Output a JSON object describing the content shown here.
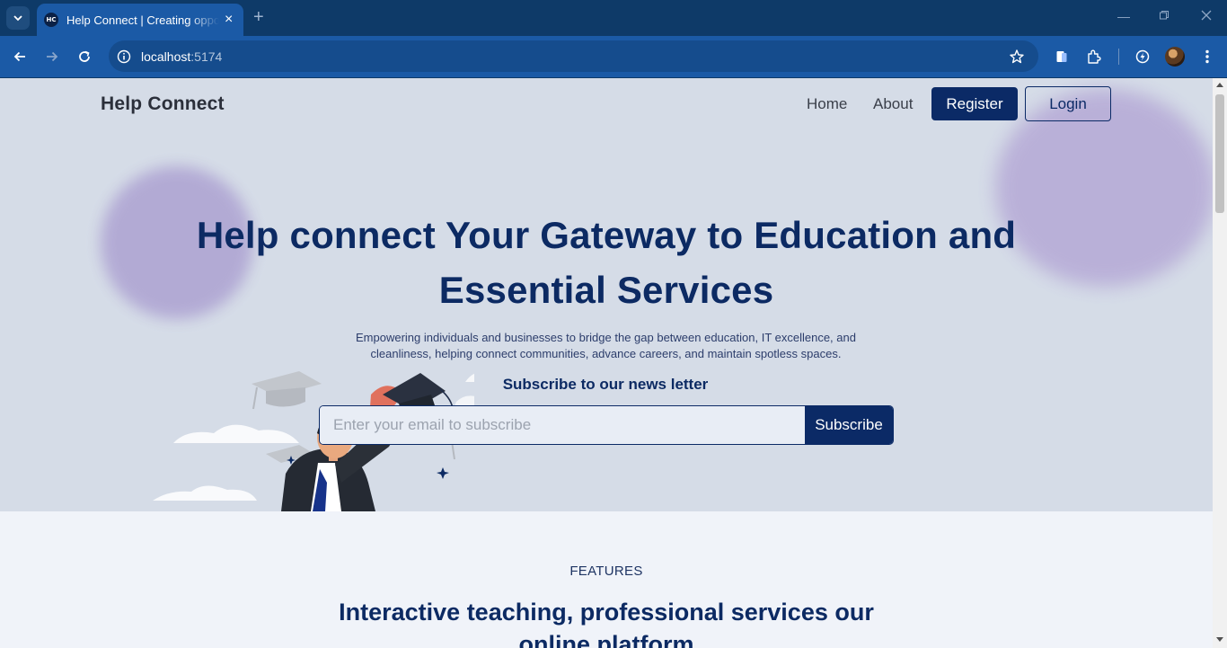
{
  "browser": {
    "tab_title": "Help Connect | Creating opportunities",
    "favicon_text": "HC",
    "url_host": "localhost",
    "url_port": ":5174",
    "accent_color": "#1b5aa6"
  },
  "navbar": {
    "brand": "Help Connect",
    "links": [
      "Home",
      "About"
    ],
    "register_label": "Register",
    "login_label": "Login"
  },
  "hero": {
    "title": "Help connect Your Gateway to Education and Essential Services",
    "subtitle": "Empowering individuals and businesses to bridge the gap between education, IT excellence, and cleanliness, helping connect communities, advance careers, and maintain spotless spaces.",
    "newsletter_title": "Subscribe to our news letter",
    "email_placeholder": "Enter your email to subscribe",
    "subscribe_label": "Subscribe",
    "brand_color": "#0c2a63"
  },
  "features": {
    "eyebrow": "FEATURES",
    "title": "Interactive teaching, professional services our online platform"
  }
}
